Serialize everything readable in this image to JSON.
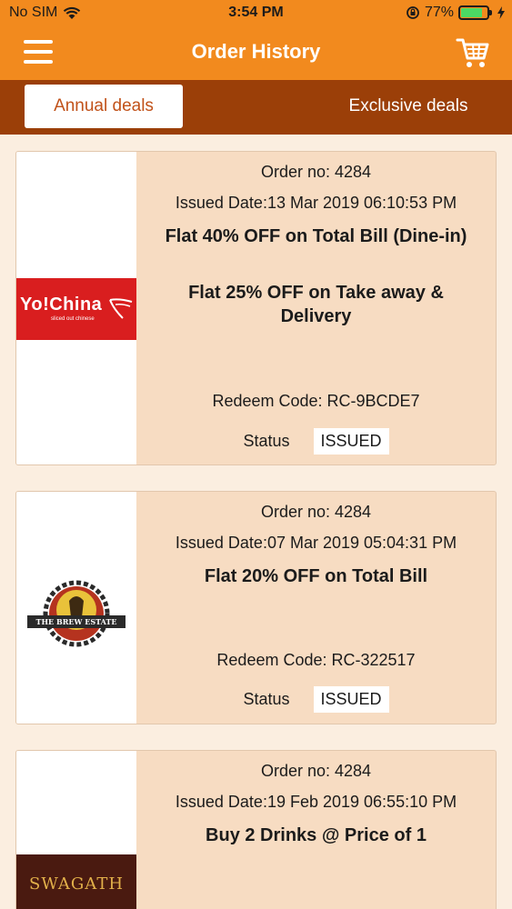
{
  "status_bar": {
    "carrier": "No SIM",
    "time": "3:54 PM",
    "battery": "77%"
  },
  "header": {
    "title": "Order History"
  },
  "tabs": {
    "active": "Annual deals",
    "inactive": "Exclusive deals"
  },
  "orders": [
    {
      "order_no": "Order no:  4284",
      "issued": "Issued Date:13 Mar 2019 06:10:53 PM",
      "offers": [
        "Flat 40% OFF on Total Bill (Dine-in)",
        "Flat 25% OFF on Take away & Delivery"
      ],
      "redeem": "Redeem Code:  RC-9BCDE7",
      "status_label": "Status",
      "status": "ISSUED",
      "logo_text": "Yo!China",
      "logo_sub": "sliced out chinese"
    },
    {
      "order_no": "Order no:  4284",
      "issued": "Issued Date:07 Mar 2019 05:04:31 PM",
      "offers": [
        "Flat 20% OFF on Total Bill"
      ],
      "redeem": "Redeem Code:  RC-322517",
      "status_label": "Status",
      "status": "ISSUED",
      "logo_text": "THE BREW ESTATE"
    },
    {
      "order_no": "Order no:  4284",
      "issued": "Issued Date:19 Feb 2019 06:55:10 PM",
      "offers": [
        "Buy 2 Drinks @ Price of 1"
      ],
      "logo_text": "SWAGATH"
    }
  ]
}
